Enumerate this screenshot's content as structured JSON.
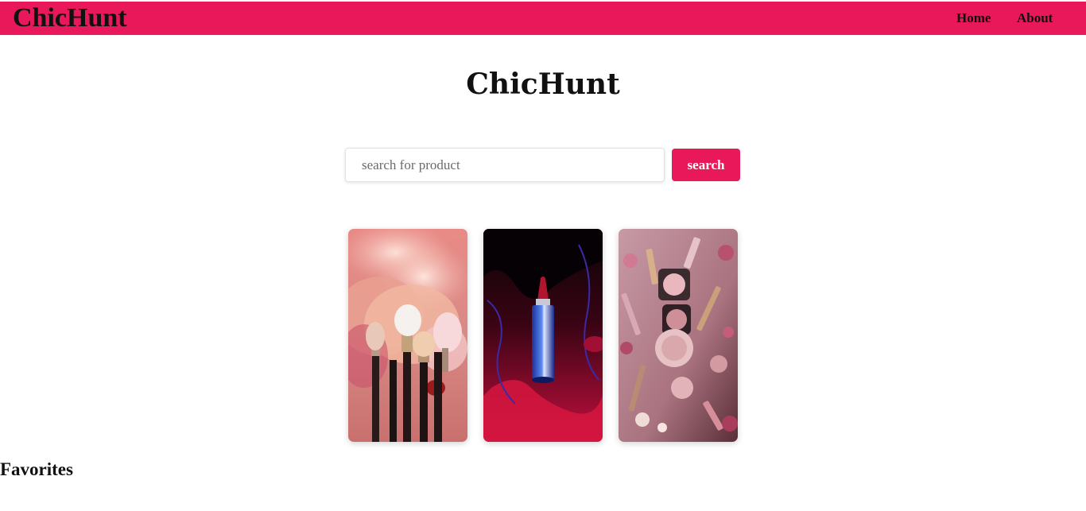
{
  "navbar": {
    "brand": "ChicHunt",
    "links": [
      {
        "label": "Home"
      },
      {
        "label": "About"
      }
    ],
    "background": "#e8185a"
  },
  "main": {
    "title": "ChicHunt",
    "search": {
      "placeholder": "search for product",
      "value": "",
      "button_label": "search",
      "button_color": "#e8185a"
    },
    "cards": [
      {
        "image": "makeup-brushes-pink-powder-image"
      },
      {
        "image": "lipstick-red-liquid-image"
      },
      {
        "image": "cosmetics-flatlay-pink-image"
      }
    ]
  },
  "favorites": {
    "heading": "Favorites"
  }
}
